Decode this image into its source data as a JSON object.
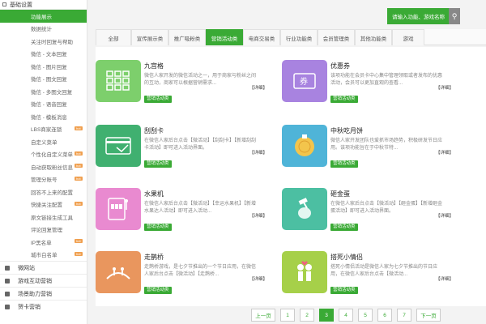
{
  "colors": {
    "accent": "#3aaa35",
    "badge": "#f0a050"
  },
  "sidebar": {
    "header": "基础设置",
    "items": [
      {
        "label": "功能展示",
        "active": true,
        "badge": ""
      },
      {
        "label": "数据统计",
        "badge": ""
      },
      {
        "label": "关注时回复与帮助",
        "badge": ""
      },
      {
        "label": "微信 - 文本回复",
        "badge": ""
      },
      {
        "label": "微信 - 图片回复",
        "badge": ""
      },
      {
        "label": "微信 - 图文回复",
        "badge": ""
      },
      {
        "label": "微信 - 多图文回复",
        "badge": ""
      },
      {
        "label": "微信 - 语音回复",
        "badge": ""
      },
      {
        "label": "微信 - 模板消息",
        "badge": ""
      },
      {
        "label": "LBS商家连锁",
        "badge": "hot"
      },
      {
        "label": "自定义菜单",
        "badge": ""
      },
      {
        "label": "个性化自定义菜单",
        "badge": "hot"
      },
      {
        "label": "自动获取粉丝信息",
        "badge": "hot"
      },
      {
        "label": "管理分账号",
        "badge": "hot"
      },
      {
        "label": "回答不上来的配置",
        "badge": ""
      },
      {
        "label": "快捷关注配置",
        "badge": "hot"
      },
      {
        "label": "原文链接生成工具",
        "badge": ""
      },
      {
        "label": "评论回复管理",
        "badge": ""
      },
      {
        "label": "IP黑名单",
        "badge": "hot"
      },
      {
        "label": "城市白名单",
        "badge": "hot"
      }
    ],
    "groups": [
      "微网站",
      "游戏互动营销",
      "场景助力营销",
      "贺卡营销"
    ]
  },
  "search": {
    "placeholder": "请输入功能、游戏名称",
    "icon": "search-icon"
  },
  "tabs": [
    "全部",
    "宣传展示类",
    "推广吸粉类",
    "营销活动类",
    "电商交易类",
    "行业功能类",
    "会员管理类",
    "其他功能类",
    "游戏"
  ],
  "active_tab": 3,
  "cards": [
    {
      "title": "九宫格",
      "desc": "微信人家开发的微信活动之一，用于商家与粉丝之间的互动，商家可以根据营销需求...",
      "more": "【详细】",
      "tag": "营销活动类",
      "color": "#7dcf6c",
      "icon": "grid-icon"
    },
    {
      "title": "优惠券",
      "desc": "该项功能在会员卡中心集中管理领取或者发布的优惠活动，会员可以更加直观的查看...",
      "more": "【详细】",
      "tag": "营销活动类",
      "color": "#a883e0",
      "icon": "coupon-icon"
    },
    {
      "title": "刮刮卡",
      "desc": "在微信人家后台点击【微活动】【刮刮卡】【新增刮刮卡活动】即可进入活动界面。",
      "more": "【详细】",
      "tag": "营销活动类",
      "color": "#40b070",
      "icon": "scratch-card-icon"
    },
    {
      "title": "中秋吃月饼",
      "desc": "微信人家开发团队也爱抓市场趋势，积极研发节日应用。该项功能旨在于中秋节特...",
      "more": "【详细】",
      "tag": "营销活动类",
      "color": "#4fb4d8",
      "icon": "mooncake-icon"
    },
    {
      "title": "水果机",
      "desc": "在微信人家后台点击【微活动】【幸运水果机】【新增水果达人活动】即可进入活动...",
      "more": "【详细】",
      "tag": "营销活动类",
      "color": "#e98ad0",
      "icon": "slot-machine-icon"
    },
    {
      "title": "砸金蛋",
      "desc": "在微信人家后台点击【微活动】【砸金蛋】【新增砸金蛋活动】即可进入活动界面。",
      "more": "【详细】",
      "tag": "营销活动类",
      "color": "#4cbfa2",
      "icon": "golden-egg-icon"
    },
    {
      "title": "走鹊桥",
      "desc": "走鹊桥游戏，是七夕节推出的一个节日应用，在微信人家后台点击【微活动】【走鹊桥...",
      "more": "【详细】",
      "tag": "营销活动类",
      "color": "#e9965e",
      "icon": "magpie-bridge-icon"
    },
    {
      "title": "搭死小情侣",
      "desc": "搭死小情侣活动是微信人家为七夕节推出的节日应用，在微信人家后台点击【微活动...",
      "more": "【详细】",
      "tag": "营销活动类",
      "color": "#a6d049",
      "icon": "couple-icon"
    }
  ],
  "pager": {
    "prev": "上一页",
    "pages": [
      "1",
      "2",
      "3",
      "4",
      "5",
      "6",
      "7"
    ],
    "current": "3",
    "next": "下一页"
  }
}
